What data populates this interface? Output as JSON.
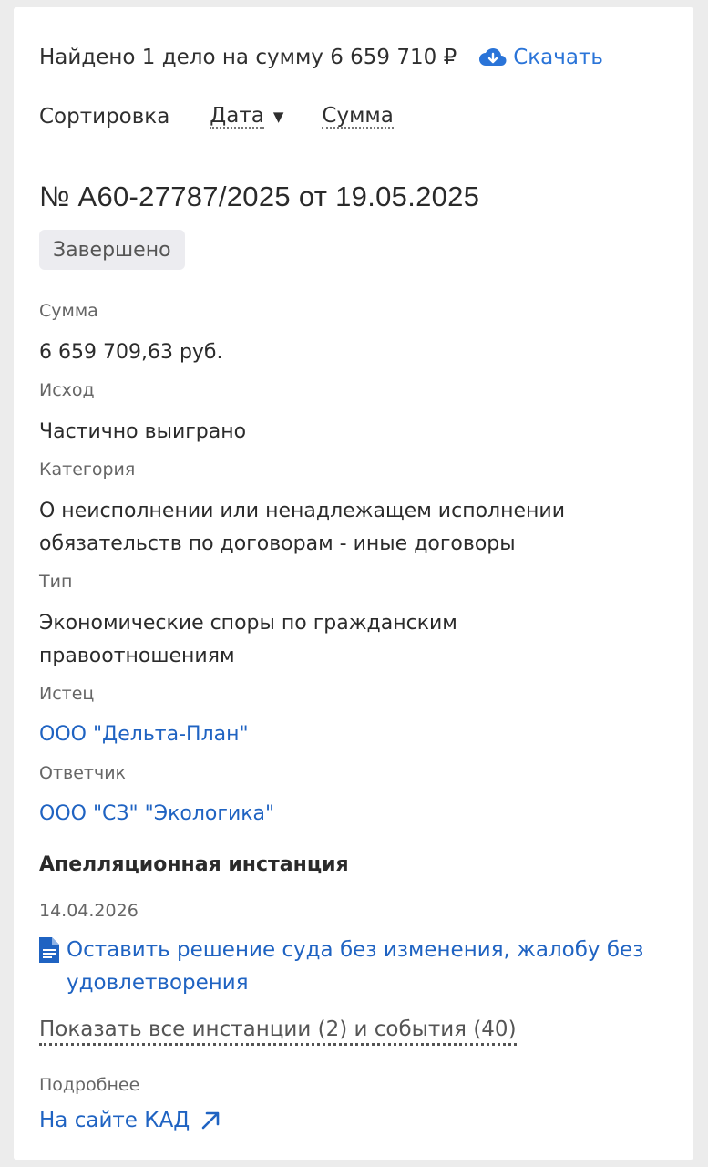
{
  "summary": {
    "text": "Найдено 1 дело на сумму 6 659 710 ₽",
    "download_label": "Скачать",
    "download_icon": "cloud-download-icon"
  },
  "sort": {
    "label": "Сортировка",
    "options": [
      {
        "label": "Дата",
        "active": true,
        "direction": "desc"
      },
      {
        "label": "Сумма",
        "active": false
      }
    ]
  },
  "case": {
    "title": "№ А60-27787/2025 от 19.05.2025",
    "status": "Завершено",
    "fields": {
      "amount": {
        "label": "Сумма",
        "value": "6 659 709,63 руб."
      },
      "outcome": {
        "label": "Исход",
        "value": "Частично выиграно"
      },
      "category": {
        "label": "Категория",
        "value": "О неисполнении или ненадлежащем исполнении обязательств по договорам - иные договоры"
      },
      "type": {
        "label": "Тип",
        "value": "Экономические споры по гражданским правоотношениям"
      },
      "plaintiff": {
        "label": "Истец",
        "value": "ООО \"Дельта-План\""
      },
      "defendant": {
        "label": "Ответчик",
        "value": "ООО \"СЗ\" \"Экологика\""
      }
    },
    "instance": {
      "title": "Апелляционная инстанция",
      "date": "14.04.2026",
      "document": "Оставить решение суда без изменения, жалобу без удовлетворения",
      "document_icon": "document-icon"
    },
    "show_all": "Показать все инстанции (2) и события (40)",
    "more_label": "Подробнее",
    "kad_link": "На сайте КАД",
    "kad_icon": "external-link-icon"
  },
  "colors": {
    "link": "#1f63c2",
    "accent": "#2a74d8",
    "badge_bg": "#ececf0"
  }
}
